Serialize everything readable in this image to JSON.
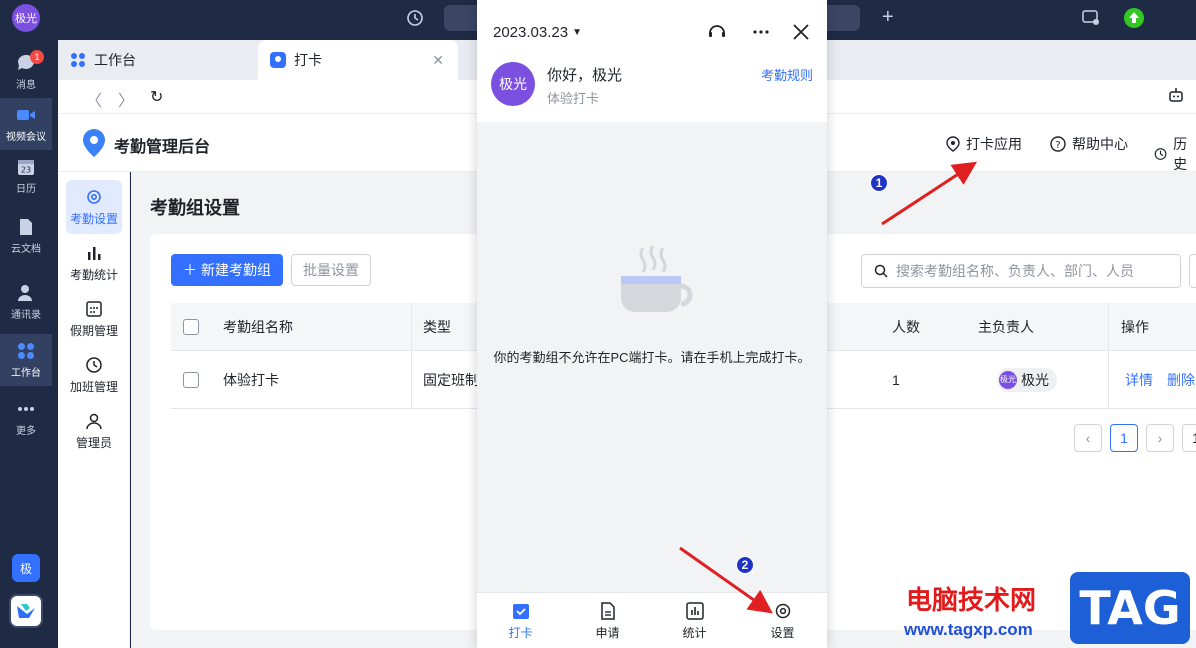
{
  "rail": {
    "avatar": "极光",
    "items": [
      {
        "label": "消息",
        "badge": "1"
      },
      {
        "label": "视频会议"
      },
      {
        "label": "日历",
        "icon_text": "23"
      },
      {
        "label": "云文档"
      },
      {
        "label": "通讯录"
      },
      {
        "label": "工作台"
      },
      {
        "label": "更多"
      }
    ],
    "bottom_app": "极"
  },
  "tabs": [
    {
      "label": "工作台"
    },
    {
      "label": "打卡"
    }
  ],
  "header": {
    "title": "考勤管理后台",
    "links": [
      "打卡应用",
      "帮助中心",
      "历史"
    ]
  },
  "side_menu": [
    {
      "label": "考勤设置"
    },
    {
      "label": "考勤统计"
    },
    {
      "label": "假期管理"
    },
    {
      "label": "加班管理"
    },
    {
      "label": "管理员"
    }
  ],
  "main": {
    "title": "考勤组设置",
    "new_button": "新建考勤组",
    "batch_button": "批量设置",
    "search_placeholder": "搜索考勤组名称、负责人、部门、人员",
    "columns": [
      "考勤组名称",
      "类型",
      "人数",
      "主负责人",
      "操作"
    ],
    "rows": [
      {
        "name": "体验打卡",
        "type": "固定班制",
        "count": "1",
        "owner_avatar": "极光",
        "owner": "极光",
        "actions": [
          "详情",
          "删除"
        ]
      }
    ],
    "pagination": {
      "current": "1",
      "last": "1"
    }
  },
  "popup": {
    "date": "2023.03.23",
    "greeting": "你好，极光",
    "group": "体验打卡",
    "rules_link": "考勤规则",
    "avatar": "极光",
    "message": "你的考勤组不允许在PC端打卡。请在手机上完成打卡。",
    "nav": [
      "打卡",
      "申请",
      "统计",
      "设置"
    ]
  },
  "annotations": {
    "marker1": "1",
    "marker2": "2"
  },
  "watermark": {
    "cn": "电脑技术网",
    "url": "www.tagxp.com",
    "tag": "TAG"
  },
  "colors": {
    "accent": "#3370ff",
    "rail_bg": "#1f2a44",
    "arrow": "#e02020"
  }
}
